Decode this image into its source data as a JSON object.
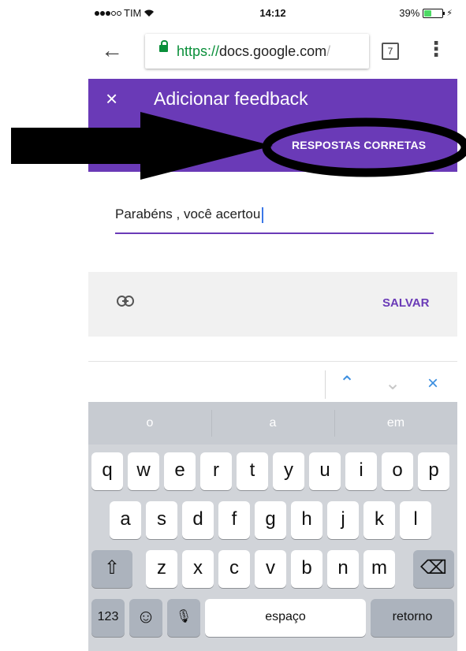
{
  "status_bar": {
    "carrier": "TIM",
    "time": "14:12",
    "battery_percent_text": "39%",
    "battery_level": 0.39
  },
  "browser": {
    "url_scheme": "https://",
    "url_host": "docs.google.com",
    "url_tail": "/",
    "tab_count": "7",
    "back_icon": "←",
    "menu_icon": "⋮"
  },
  "header": {
    "close_icon": "×",
    "title": "Adicionar feedback",
    "correct_answers_button": "RESPOSTAS CORRETAS"
  },
  "feedback": {
    "text": "Parabéns , você acertou"
  },
  "actions": {
    "save_label": "SALVAR"
  },
  "accessory": {
    "up": "⌃",
    "down": "⌄",
    "close": "×"
  },
  "keyboard": {
    "suggestions": [
      "o",
      "a",
      "em"
    ],
    "row1": [
      "q",
      "w",
      "e",
      "r",
      "t",
      "y",
      "u",
      "i",
      "o",
      "p"
    ],
    "row2": [
      "a",
      "s",
      "d",
      "f",
      "g",
      "h",
      "j",
      "k",
      "l"
    ],
    "row3": [
      "z",
      "x",
      "c",
      "v",
      "b",
      "n",
      "m"
    ],
    "shift": "⇧",
    "backspace": "⌫",
    "numbers_key": "123",
    "emoji_key": "☺",
    "mic_key": "🎙",
    "space_key": "espaço",
    "return_key": "retorno"
  },
  "colors": {
    "accent": "#6a3ab7",
    "secure_green": "#0a8f3a",
    "ios_blue": "#3c8fe0",
    "annotation": "#000000"
  }
}
